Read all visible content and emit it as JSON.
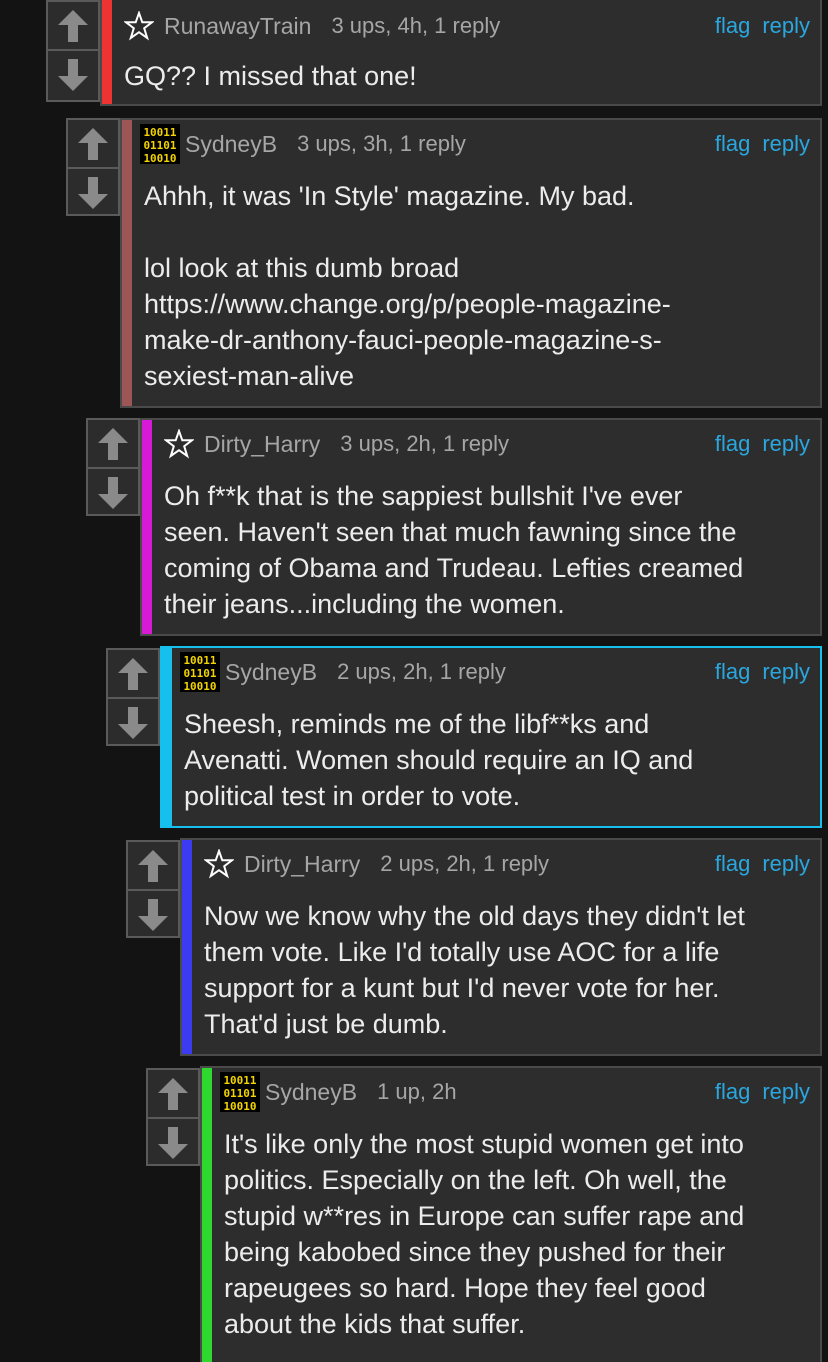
{
  "colors": {
    "background": "#131313",
    "link": "#2aa7df",
    "meta_text": "#a6a6a6",
    "body_text": "#ececec"
  },
  "comments": [
    {
      "user": "RunawayTrain",
      "badge": "star-icon",
      "meta": "3 ups, 4h, 1 reply",
      "flag": "flag",
      "reply": "reply",
      "text": "GQ?? I missed that one!",
      "thread_color": "#ee3333"
    },
    {
      "user": "SydneyB",
      "badge": "binary-avatar-icon",
      "meta": "3 ups, 3h, 1 reply",
      "flag": "flag",
      "reply": "reply",
      "text": "Ahhh, it was 'In Style' magazine. My bad.\n\nlol look at this dumb broad\nhttps://www.change.org/p/people-magazine-\nmake-dr-anthony-fauci-people-magazine-s-\nsexiest-man-alive",
      "thread_color": "#9c5656"
    },
    {
      "user": "Dirty_Harry",
      "badge": "star-icon",
      "meta": "3 ups, 2h, 1 reply",
      "flag": "flag",
      "reply": "reply",
      "text": "Oh f**k that is the sappiest bullshit I've ever\nseen. Haven't seen that much fawning since the\ncoming of Obama and Trudeau. Lefties creamed\ntheir jeans...including the women.",
      "thread_color": "#d61ad6"
    },
    {
      "user": "SydneyB",
      "badge": "binary-avatar-icon",
      "meta": "2 ups, 2h, 1 reply",
      "flag": "flag",
      "reply": "reply",
      "text": "Sheesh, reminds me of the libf**ks and\nAvenatti. Women should require an IQ and\npolitical test in order to vote.",
      "thread_color": "#17bfef"
    },
    {
      "user": "Dirty_Harry",
      "badge": "star-icon",
      "meta": "2 ups, 2h, 1 reply",
      "flag": "flag",
      "reply": "reply",
      "text": "Now we know why the old days they didn't let\nthem vote. Like I'd totally use AOC for a life\nsupport for a kunt but I'd never vote for her.\nThat'd just be dumb.",
      "thread_color": "#3b3bf2"
    },
    {
      "user": "SydneyB",
      "badge": "binary-avatar-icon",
      "meta": "1 up, 2h",
      "flag": "flag",
      "reply": "reply",
      "text": "It's like only the most stupid women get into\npolitics. Especially on the left. Oh well, the\nstupid w**res in Europe can suffer rape and\nbeing kabobed since they pushed for their\nrapeugees so hard. Hope they feel good\nabout the kids that suffer.",
      "thread_color": "#2fd82f"
    }
  ]
}
